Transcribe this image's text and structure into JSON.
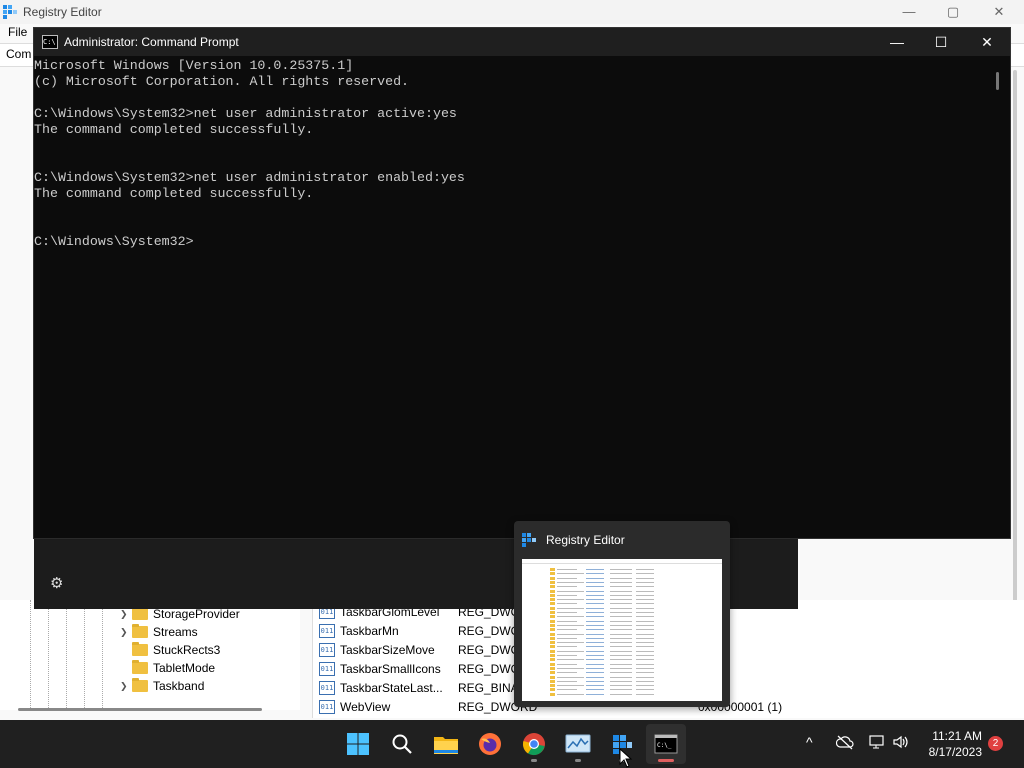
{
  "registry_editor": {
    "title": "Registry Editor",
    "menu": {
      "file": "File"
    },
    "address_prefix": "Com",
    "window_controls": {
      "minimize": "—",
      "maximize": "▢",
      "close": "✕"
    },
    "tree": [
      {
        "label": "StorageProvider",
        "expandable": true
      },
      {
        "label": "Streams",
        "expandable": true
      },
      {
        "label": "StuckRects3",
        "expandable": false
      },
      {
        "label": "TabletMode",
        "expandable": false
      },
      {
        "label": "Taskband",
        "expandable": true
      }
    ],
    "values": [
      {
        "name": "TaskbarGlomLevel",
        "type": "REG_DWORD",
        "data": ""
      },
      {
        "name": "TaskbarMn",
        "type": "REG_DWORD",
        "data": ""
      },
      {
        "name": "TaskbarSizeMove",
        "type": "REG_DWORD",
        "data": ""
      },
      {
        "name": "TaskbarSmallIcons",
        "type": "REG_DWORD",
        "data": ""
      },
      {
        "name": "TaskbarStateLast...",
        "type": "REG_BINARY",
        "data": ""
      },
      {
        "name": "WebView",
        "type": "REG_DWORD",
        "data": "0x00000001 (1)"
      }
    ]
  },
  "command_prompt": {
    "title": "Administrator: Command Prompt",
    "window_controls": {
      "minimize": "—",
      "maximize": "☐",
      "close": "✕"
    },
    "lines": [
      "Microsoft Windows [Version 10.0.25375.1]",
      "(c) Microsoft Corporation. All rights reserved.",
      "",
      "C:\\Windows\\System32>net user administrator active:yes",
      "The command completed successfully.",
      "",
      "",
      "C:\\Windows\\System32>net user administrator enabled:yes",
      "The command completed successfully.",
      "",
      "",
      "C:\\Windows\\System32>"
    ],
    "settings_icon": "gear-icon"
  },
  "preview": {
    "title": "Registry Editor"
  },
  "taskbar": {
    "apps": [
      {
        "name": "start",
        "icon": "windows-logo-icon",
        "running": false
      },
      {
        "name": "search",
        "icon": "search-icon",
        "running": false
      },
      {
        "name": "file-explorer",
        "icon": "folder-icon",
        "running": false
      },
      {
        "name": "firefox",
        "icon": "firefox-icon",
        "running": false
      },
      {
        "name": "chrome",
        "icon": "chrome-icon",
        "running": true
      },
      {
        "name": "resource-monitor",
        "icon": "monitor-chart-icon",
        "running": true
      },
      {
        "name": "registry-editor",
        "icon": "registry-icon",
        "running": true
      },
      {
        "name": "command-prompt",
        "icon": "terminal-icon",
        "running": true,
        "active": true
      }
    ],
    "tray": {
      "chevron": "^",
      "time": "11:21 AM",
      "date": "8/17/2023",
      "notifications": "2"
    }
  },
  "colors": {
    "cmd_bg": "#0c0c0c",
    "cmd_text": "#cccccc",
    "taskbar_bg": "#202020",
    "accent": "#0078d4"
  }
}
